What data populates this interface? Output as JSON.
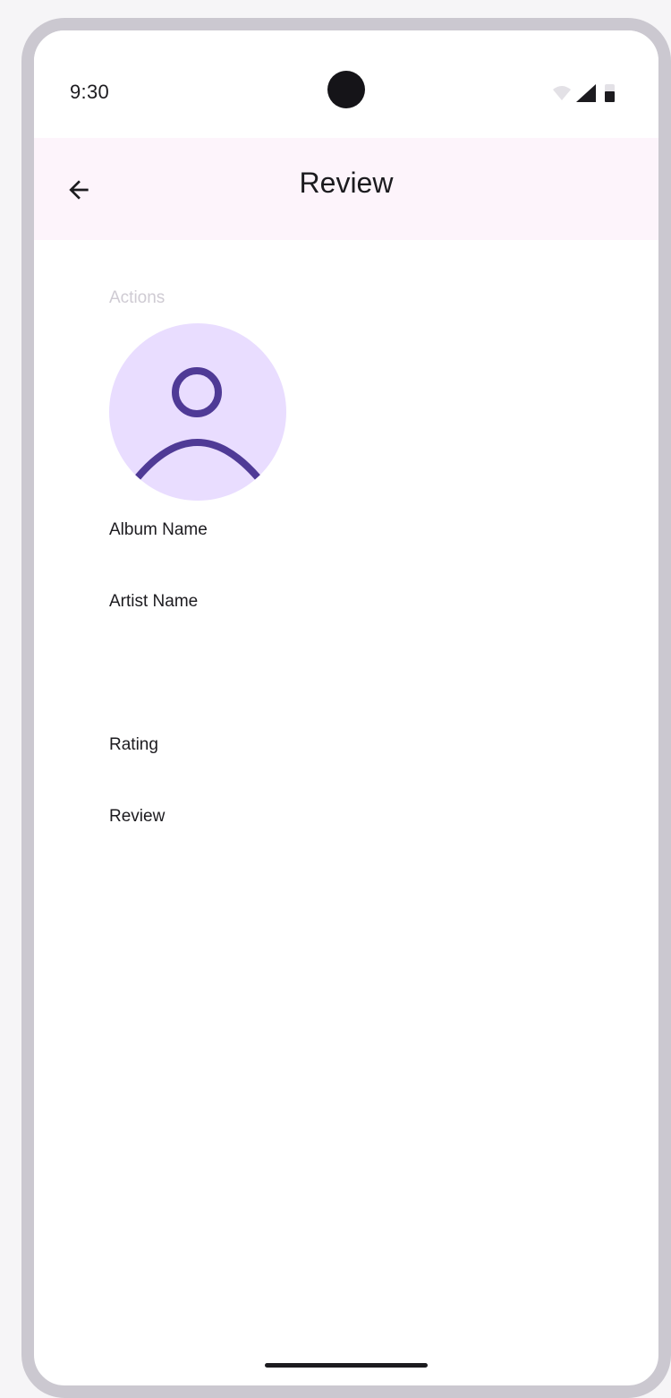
{
  "status_bar": {
    "time": "9:30"
  },
  "app_bar": {
    "title": "Review",
    "back_icon": "arrow-back-icon"
  },
  "content": {
    "section_label": "Actions",
    "avatar_icon": "person-icon",
    "album_name": "Album Name",
    "artist_name": "Artist Name",
    "rating": "Rating",
    "review": "Review"
  },
  "colors": {
    "app_bar_bg": "#fdf4fb",
    "avatar_bg": "#e9ddff",
    "avatar_icon": "#4f3a96",
    "frame": "#cbc8d0"
  }
}
